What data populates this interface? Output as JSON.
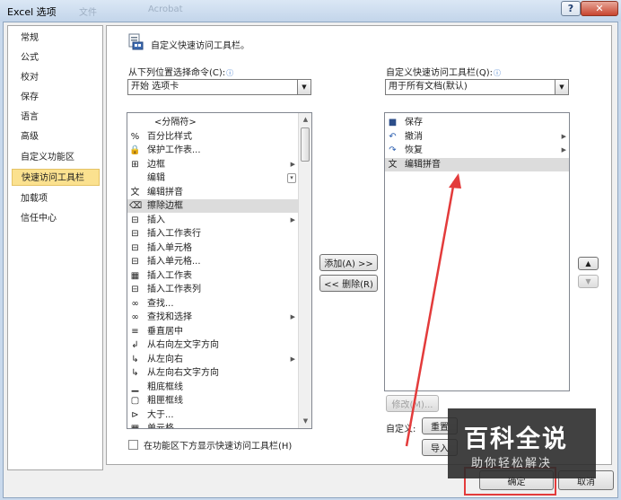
{
  "window": {
    "title": "Excel 选项",
    "ghost_text_1": "文件",
    "ghost_text_2": "Acrobat",
    "help_label": "?",
    "close_label": "✕"
  },
  "nav": {
    "items": [
      "常规",
      "公式",
      "校对",
      "保存",
      "语言",
      "高级",
      "自定义功能区",
      "快速访问工具栏",
      "加载项",
      "信任中心"
    ],
    "selected": "快速访问工具栏"
  },
  "header": {
    "text": "自定义快速访问工具栏。"
  },
  "left": {
    "label": "从下列位置选择命令(C):",
    "combo_value": "开始 选项卡",
    "items": [
      {
        "label": "<分隔符>",
        "icon": "none"
      },
      {
        "label": "百分比样式",
        "icon": "percent-icon"
      },
      {
        "label": "保护工作表...",
        "icon": "lock-icon"
      },
      {
        "label": "边框",
        "icon": "borders-icon",
        "submenu": true
      },
      {
        "label": "编辑",
        "icon": "none",
        "dropdown": true
      },
      {
        "label": "编辑拼音",
        "icon": "phonetic-icon"
      },
      {
        "label": "擦除边框",
        "icon": "eraser-icon"
      },
      {
        "label": "插入",
        "icon": "insert-icon",
        "submenu": true
      },
      {
        "label": "插入工作表行",
        "icon": "insert-row-icon"
      },
      {
        "label": "插入单元格",
        "icon": "insert-cells-icon"
      },
      {
        "label": "插入单元格...",
        "icon": "insert-cells-dialog-icon"
      },
      {
        "label": "插入工作表",
        "icon": "insert-sheet-icon"
      },
      {
        "label": "插入工作表列",
        "icon": "insert-column-icon"
      },
      {
        "label": "查找...",
        "icon": "binoculars-icon"
      },
      {
        "label": "查找和选择",
        "icon": "find-select-icon",
        "submenu": true
      },
      {
        "label": "垂直居中",
        "icon": "align-middle-icon"
      },
      {
        "label": "从右向左文字方向",
        "icon": "rtl-icon"
      },
      {
        "label": "从左向右",
        "icon": "ltr-icon",
        "submenu": true
      },
      {
        "label": "从左向右文字方向",
        "icon": "ltr-text-icon"
      },
      {
        "label": "粗底框线",
        "icon": "thick-bottom-border-icon"
      },
      {
        "label": "粗匣框线",
        "icon": "thick-box-border-icon"
      },
      {
        "label": "大于...",
        "icon": "greater-than-icon"
      },
      {
        "label": "单元格",
        "icon": "cells-icon"
      }
    ],
    "selected": "擦除边框"
  },
  "right": {
    "label": "自定义快速访问工具栏(Q):",
    "combo_value": "用于所有文档(默认)",
    "items": [
      {
        "label": "保存",
        "icon": "save-icon"
      },
      {
        "label": "撤消",
        "icon": "undo-icon",
        "submenu": true
      },
      {
        "label": "恢复",
        "icon": "redo-icon",
        "submenu": true
      },
      {
        "label": "编辑拼音",
        "icon": "phonetic-icon"
      }
    ],
    "selected": "编辑拼音"
  },
  "buttons": {
    "add": "添加(A) >>",
    "remove": "<< 删除(R)",
    "modify": "修改(M)...",
    "custom_label": "自定义:",
    "reset": "重置",
    "import_export": "导入",
    "ok": "确定",
    "cancel": "取消",
    "move_up": "▲",
    "move_down": "▼"
  },
  "checkbox": {
    "label": "在功能区下方显示快速访问工具栏(H)",
    "checked": false
  },
  "watermark": {
    "main": "百科全说",
    "sub": "助你轻松解决"
  },
  "colors": {
    "selection": "#fbe18f",
    "annotation": "#e33b3b"
  }
}
